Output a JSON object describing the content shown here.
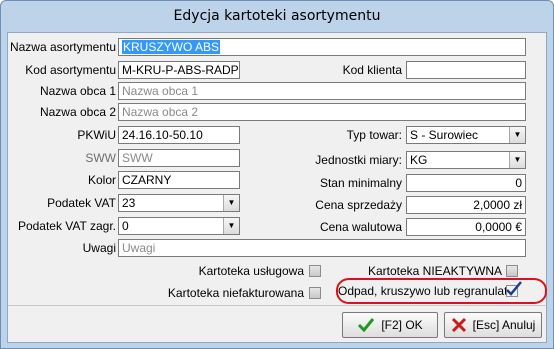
{
  "window": {
    "title": "Edycja kartoteki asortymentu"
  },
  "form": {
    "nazwa_asortymentu": {
      "label": "Nazwa asortymentu",
      "value": "KRUSZYWO ABS"
    },
    "kod_asortymentu": {
      "label": "Kod asortymentu",
      "value": "M-KRU-P-ABS-RADPOL"
    },
    "kod_klienta": {
      "label": "Kod klienta",
      "value": ""
    },
    "nazwa_obca_1": {
      "label": "Nazwa obca 1",
      "placeholder": "Nazwa obca 1"
    },
    "nazwa_obca_2": {
      "label": "Nazwa obca 2",
      "placeholder": "Nazwa obca 2"
    },
    "pkwiu": {
      "label": "PKWiU",
      "value": "24.16.10-50.10"
    },
    "sww": {
      "label": "SWW",
      "placeholder": "SWW"
    },
    "kolor": {
      "label": "Kolor",
      "value": "CZARNY"
    },
    "podatek_vat": {
      "label": "Podatek VAT",
      "value": "23"
    },
    "podatek_vat_zagr": {
      "label": "Podatek VAT zagr.",
      "value": "0"
    },
    "uwagi": {
      "label": "Uwagi",
      "placeholder": "Uwagi"
    },
    "typ_towar": {
      "label": "Typ towar:",
      "value": "S - Surowiec"
    },
    "jednostki_miary": {
      "label": "Jednostki miary:",
      "value": "KG"
    },
    "stan_minimalny": {
      "label": "Stan minimalny",
      "value": "0"
    },
    "cena_sprzedazy": {
      "label": "Cena sprzedaży",
      "value": "2,0000 zł"
    },
    "cena_walutowa": {
      "label": "Cena walutowa",
      "value": "0,0000 €"
    }
  },
  "checkboxes": {
    "kartoteka_uslugowa": {
      "label": "Kartoteka usługowa",
      "checked": false
    },
    "kartoteka_nieaktywna": {
      "label": "Kartoteka NIEAKTYWNA",
      "checked": false
    },
    "kartoteka_niefakturowana": {
      "label": "Kartoteka niefakturowana",
      "checked": false
    },
    "odpad": {
      "label": "Odpad, kruszywo lub regranulat:",
      "checked": true
    }
  },
  "buttons": {
    "ok": {
      "label": "[F2] OK"
    },
    "cancel": {
      "label": "[Esc] Anuluj"
    }
  },
  "colors": {
    "highlight": "#e0101a",
    "selection": "#3399ff",
    "ok_icon": "#1f9a1f",
    "cancel_icon": "#d01818"
  }
}
